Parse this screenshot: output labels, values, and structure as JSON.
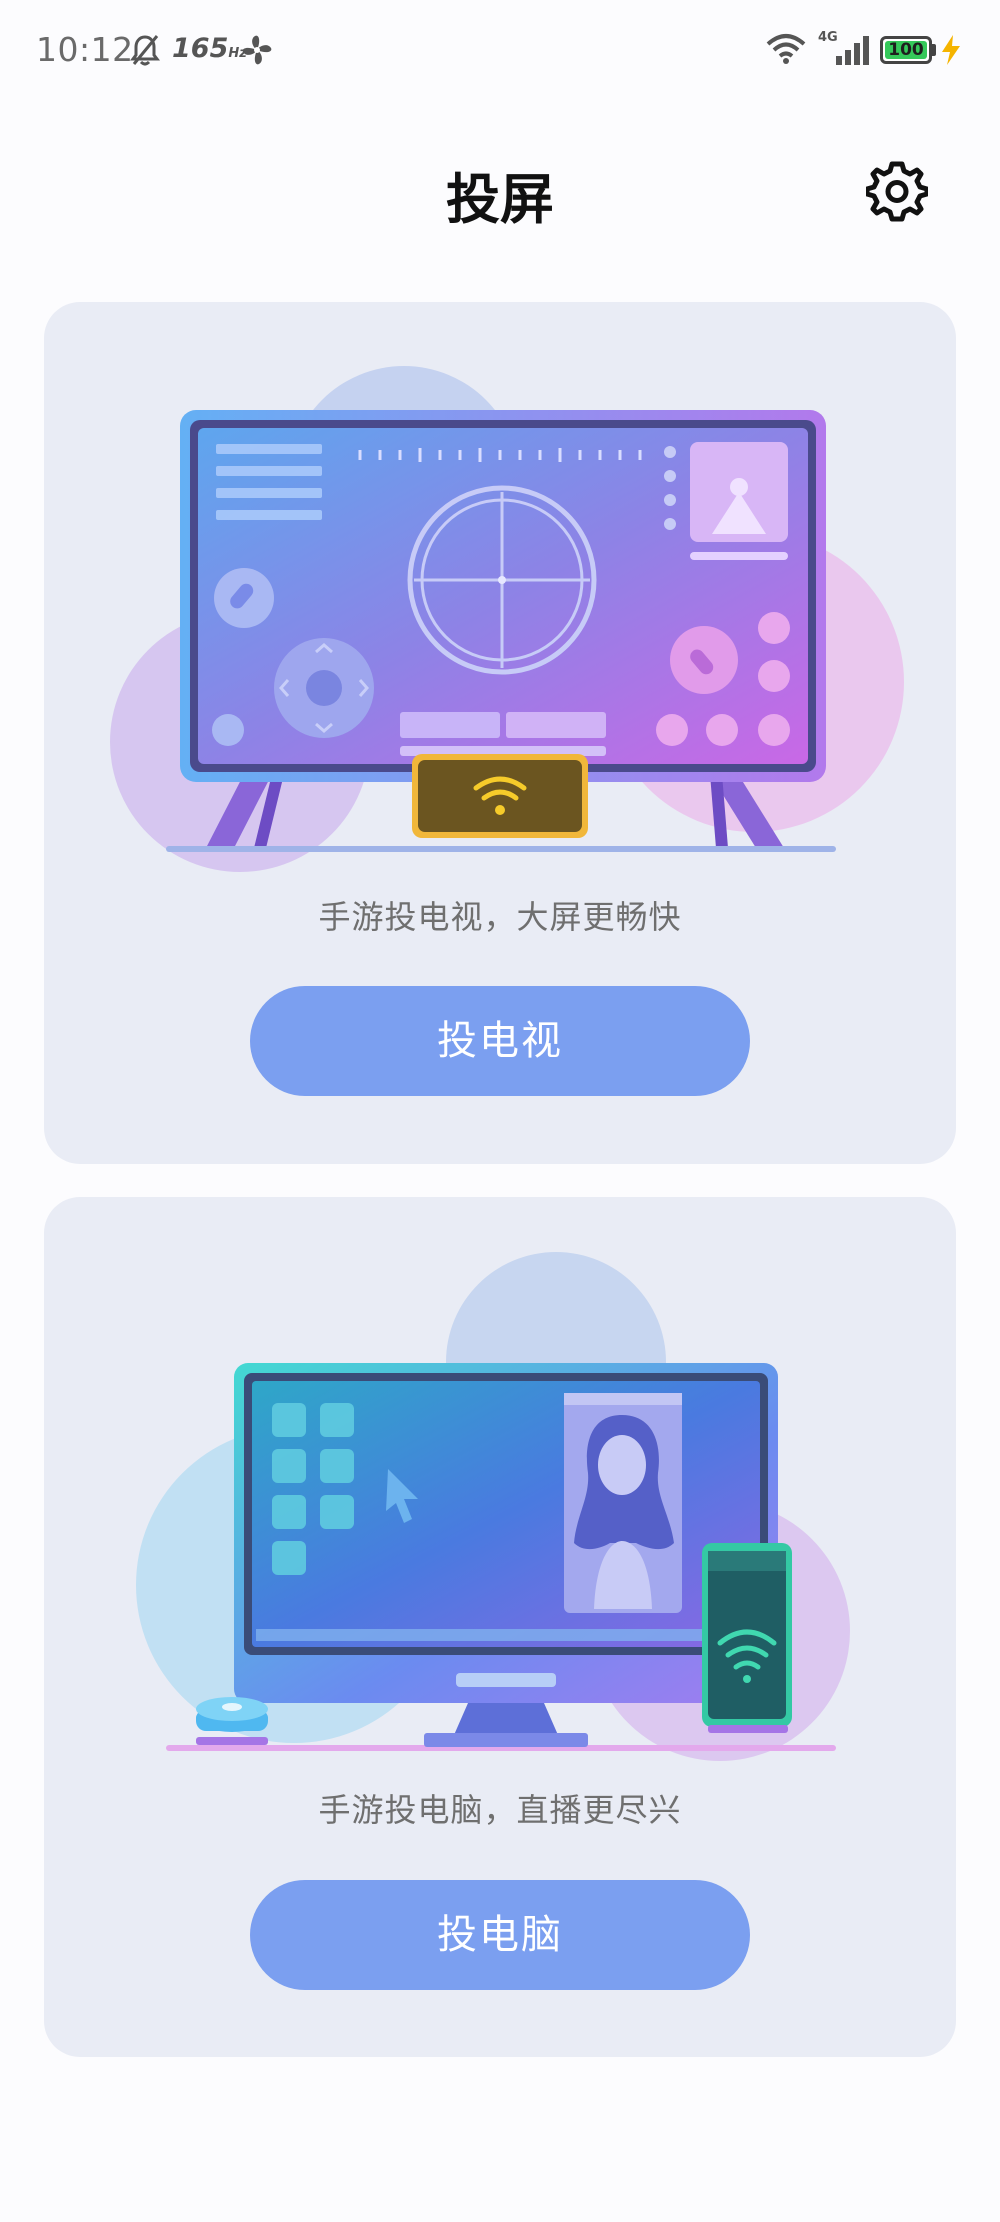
{
  "status_bar": {
    "time": "10:12",
    "refresh_rate": "165",
    "refresh_unit": "Hz",
    "network": "4G",
    "battery": "100",
    "icons": [
      "mute-icon",
      "fan-icon",
      "wifi-icon",
      "signal-icon",
      "battery-icon",
      "charging-bolt-icon"
    ]
  },
  "header": {
    "title": "投屏",
    "settings_icon": "gear-icon"
  },
  "cards": {
    "tv": {
      "description": "手游投电视，大屏更畅快",
      "button_label": "投电视"
    },
    "pc": {
      "description": "手游投电脑，直播更尽兴",
      "button_label": "投电脑"
    }
  },
  "colors": {
    "card_bg": "#e9ecf5",
    "button_bg": "#7b9ff0",
    "title": "#111111",
    "description": "#6f6f6f"
  }
}
